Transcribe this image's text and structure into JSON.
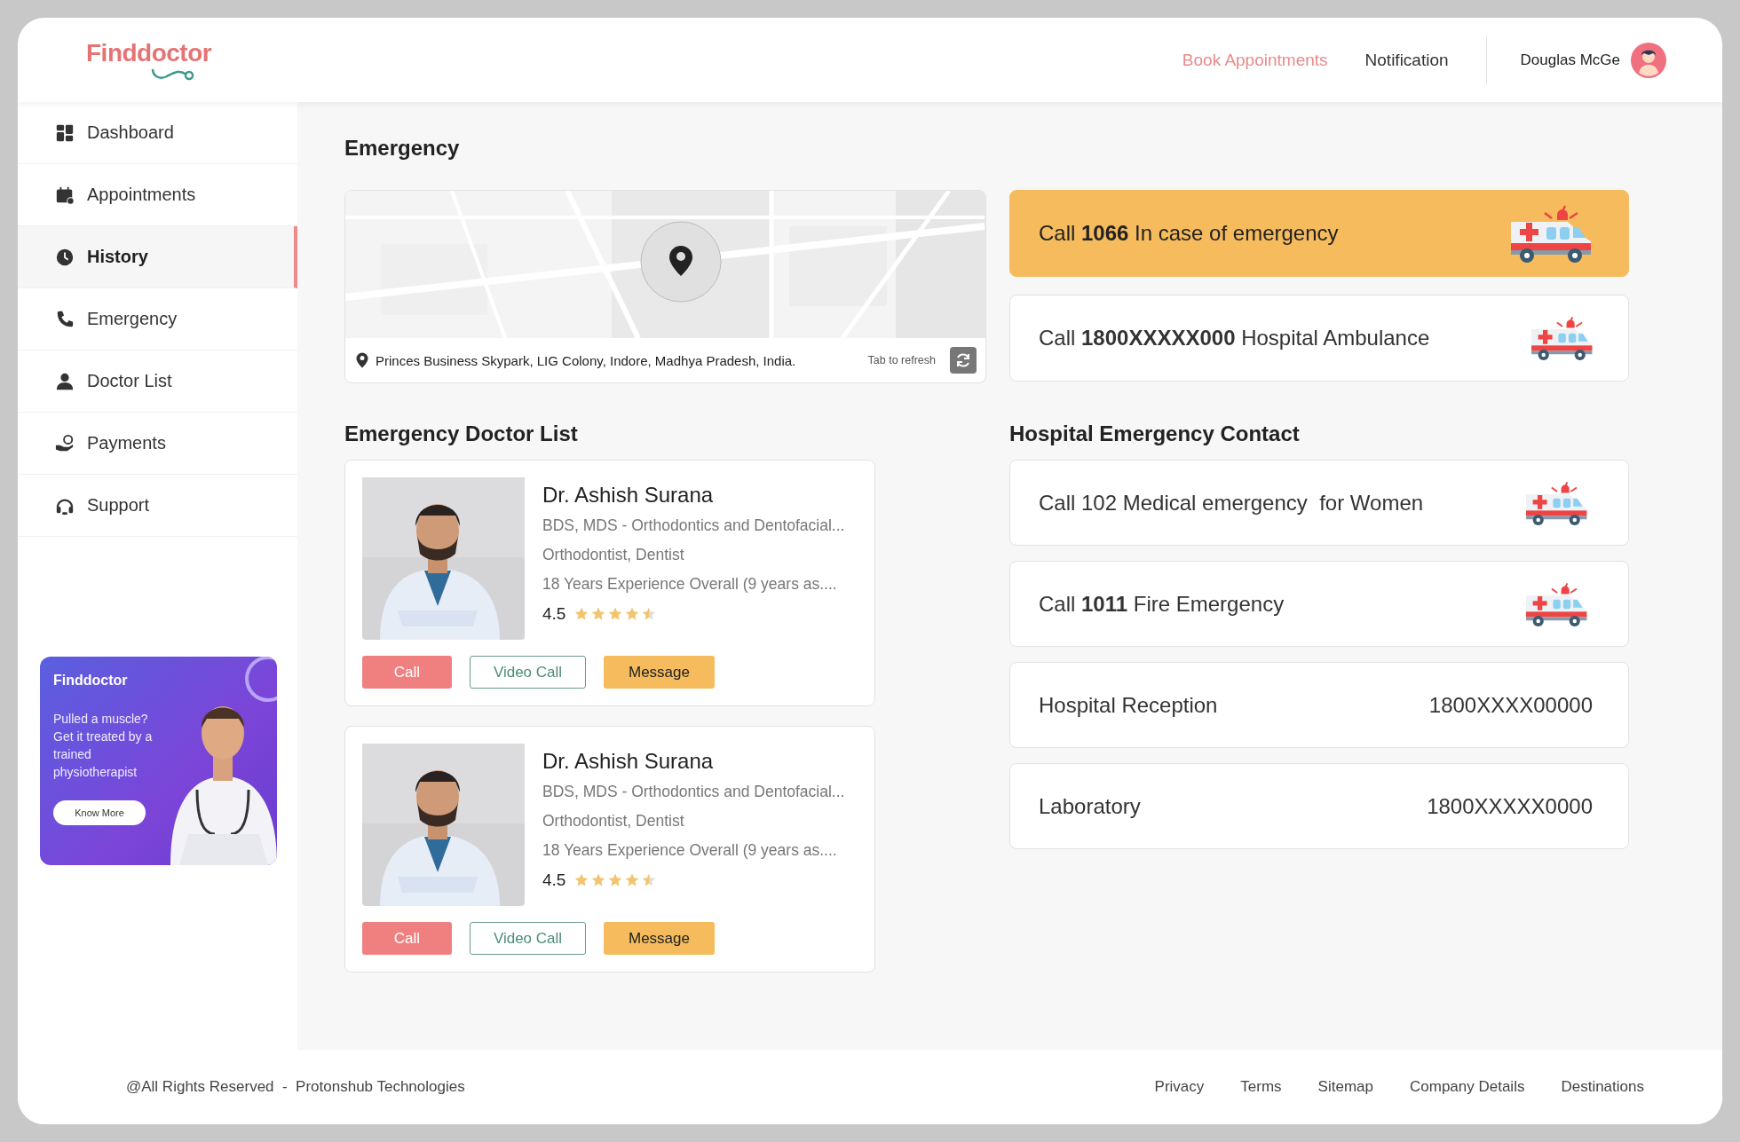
{
  "header": {
    "logo": "Finddoctor",
    "nav": [
      {
        "label": "Book Appointments",
        "selected": true
      },
      {
        "label": "Notification",
        "selected": false
      }
    ],
    "user": {
      "name": "Douglas McGe"
    }
  },
  "sidebar": {
    "items": [
      {
        "label": "Dashboard",
        "selected": false
      },
      {
        "label": "Appointments",
        "selected": false
      },
      {
        "label": "History",
        "selected": true
      },
      {
        "label": "Emergency",
        "selected": false
      },
      {
        "label": "Doctor List",
        "selected": false
      },
      {
        "label": "Payments",
        "selected": false
      },
      {
        "label": "Support",
        "selected": false
      }
    ],
    "banner": {
      "logo": "Finddoctor",
      "text": "Pulled a muscle? Get it treated by a trained physiotherapist",
      "button": "Know More"
    }
  },
  "emergency": {
    "title": "Emergency",
    "map": {
      "address": "Princes Business Skypark, LIG Colony, Indore, Madhya Pradesh, India.",
      "refresh_hint": "Tab to refresh"
    },
    "calls": [
      {
        "text": "Call **1066** In case of emergency",
        "highlighted": true
      },
      {
        "text": "Call **1800XXXXX000** Hospital Ambulance",
        "highlighted": false
      }
    ]
  },
  "doctor_list": {
    "title": "Emergency Doctor List",
    "doctors": [
      {
        "name": "Dr. Ashish Surana",
        "degree": "BDS, MDS - Orthodontics and Dentofacial...",
        "specialty": "Orthodontist, Dentist",
        "experience": "18 Years Experience Overall (9 years as....",
        "rating": "4.5",
        "stars": 4.5,
        "actions": [
          "Call",
          "Video Call",
          "Message"
        ]
      },
      {
        "name": "Dr. Ashish Surana",
        "degree": "BDS, MDS - Orthodontics and Dentofacial...",
        "specialty": "Orthodontist, Dentist",
        "experience": "18 Years Experience Overall (9 years as....",
        "rating": "4.5",
        "stars": 4.5,
        "actions": [
          "Call",
          "Video Call",
          "Message"
        ]
      }
    ]
  },
  "hospital_contacts": {
    "title": "Hospital Emergency Contact",
    "items": [
      {
        "kind": "call",
        "text": "Call 102 Medical emergency  for Women"
      },
      {
        "kind": "call",
        "text": "Call **1011** Fire Emergency"
      },
      {
        "kind": "number",
        "label": "Hospital Reception",
        "number": "1800XXXX00000"
      },
      {
        "kind": "number",
        "label": "Laboratory",
        "number": "1800XXXXX0000"
      }
    ]
  },
  "footer": {
    "copyright": "@All Rights Reserved  -  Protonshub Technologies",
    "links": [
      "Privacy",
      "Terms",
      "Sitemap",
      "Company Details",
      "Destinations"
    ]
  }
}
